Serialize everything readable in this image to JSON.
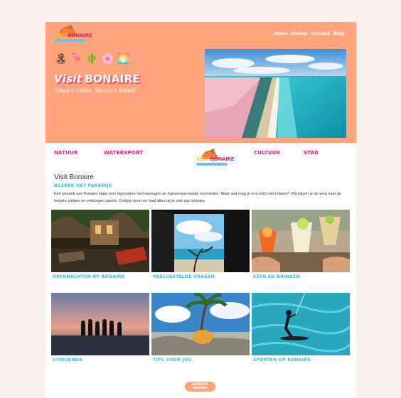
{
  "brand": {
    "logo_part1": "VISIT",
    "logo_part2": "BONAIRE"
  },
  "nav": {
    "items": [
      "Home",
      "Natuur",
      "Contact",
      "Blog"
    ]
  },
  "hero": {
    "emojis": [
      "🏝",
      "🦩",
      "🌵",
      "🌸",
      "🌅"
    ],
    "title_italic": "Visit",
    "title_bold": "BONAIRE",
    "subtitle": "'Once a visitor, always a friend!'"
  },
  "categories": [
    "NATUUR",
    "WATERSPORT",
    "CULTUUR",
    "STAD"
  ],
  "intro": {
    "title": "Visit Bonaire",
    "subtitle": "BEZOEK HET PARADIJS",
    "text": "Een bezoek aan Bonaire staat voor bijzondere herinneringen en hartverwarmende momenten. Maar wat mag je nou echt niet missen? Wij wijzen je de weg naar de leukste plekjes en verborgen parels. Ontdek meer en haal alles uit je visit aan bonaire."
  },
  "cards": [
    "OVERNACHTEN OP BONAIRE",
    "VEELGESTELDE VRAGEN",
    "ETEN EN DRINKEN",
    "UITAGENDA",
    "TIPS VOOR JOU",
    "SPORTEN OP BONAIRE"
  ],
  "button": {
    "label": "ANDERE PAGINA"
  },
  "colors": {
    "hero_bg": "#ffa47c",
    "accent_pink": "#e91e78",
    "accent_blue": "#34bfe0",
    "page_bg": "#fdf1ee"
  }
}
